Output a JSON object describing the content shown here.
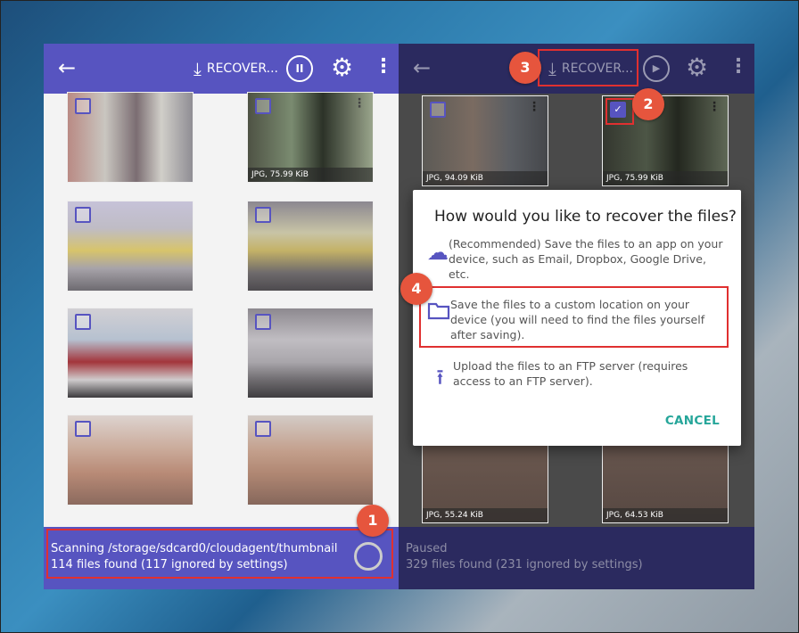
{
  "left_panel": {
    "toolbar": {
      "back_icon": "←",
      "recover_label": "RECOVER...",
      "pause_icon": "II",
      "gear_icon": "⚙",
      "more_icon": "⋮"
    },
    "tiles": [
      {
        "caption": ""
      },
      {
        "caption": "JPG, 75.99 KiB"
      }
    ],
    "status": {
      "line1": "Scanning /storage/sdcard0/cloudagent/thumbnail",
      "line2": "114 files found (117 ignored by settings)"
    }
  },
  "right_panel": {
    "toolbar": {
      "back_icon": "←",
      "recover_label": "RECOVER...",
      "play_icon": "▶",
      "gear_icon": "⚙",
      "more_icon": "⋮"
    },
    "tiles": [
      {
        "caption": "JPG, 94.09 KiB"
      },
      {
        "caption": "JPG, 75.99 KiB"
      },
      {
        "caption": "JPG, 55.24 KiB"
      },
      {
        "caption": "JPG, 64.53 KiB"
      }
    ],
    "status": {
      "line1": "Paused",
      "line2": "329 files found (231 ignored by settings)"
    }
  },
  "dialog": {
    "title": "How would you like to recover the files?",
    "options": [
      {
        "icon": "cloud-upload",
        "text": "(Recommended) Save the files to an app on your device, such as Email, Dropbox, Google Drive, etc."
      },
      {
        "icon": "folder",
        "text": "Save the files to a custom location on your device (you will need to find the files yourself after saving)."
      },
      {
        "icon": "upload",
        "text": "Upload the files to an FTP server (requires access to an FTP server)."
      }
    ],
    "cancel_label": "CANCEL"
  },
  "badges": [
    "1",
    "2",
    "3",
    "4"
  ],
  "colors": {
    "accent": "#5754c0",
    "badge": "#e6553d",
    "highlight": "#e03030",
    "cancel": "#26a69a"
  }
}
